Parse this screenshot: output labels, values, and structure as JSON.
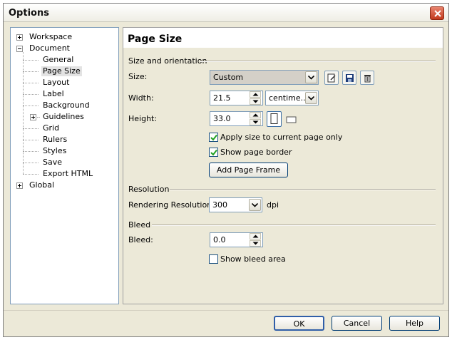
{
  "window": {
    "title": "Options"
  },
  "tree": {
    "items": [
      {
        "label": "Workspace",
        "level": 0,
        "expander": "plus"
      },
      {
        "label": "Document",
        "level": 0,
        "expander": "minus"
      },
      {
        "label": "General",
        "level": 1
      },
      {
        "label": "Page Size",
        "level": 1,
        "selected": true
      },
      {
        "label": "Layout",
        "level": 1
      },
      {
        "label": "Label",
        "level": 1
      },
      {
        "label": "Background",
        "level": 1
      },
      {
        "label": "Guidelines",
        "level": 1,
        "expander": "plus"
      },
      {
        "label": "Grid",
        "level": 1
      },
      {
        "label": "Rulers",
        "level": 1
      },
      {
        "label": "Styles",
        "level": 1
      },
      {
        "label": "Save",
        "level": 1
      },
      {
        "label": "Export HTML",
        "level": 1
      },
      {
        "label": "Global",
        "level": 0,
        "expander": "plus"
      }
    ]
  },
  "page": {
    "title": "Page Size",
    "size_orientation": {
      "section": "Size and orientation",
      "size_label": "Size:",
      "size_value": "Custom",
      "width_label": "Width:",
      "width_value": "21.5",
      "unit_value": "centime...",
      "height_label": "Height:",
      "height_value": "33.0",
      "apply_current_label": "Apply size to current page only",
      "apply_current_checked": true,
      "show_border_label": "Show page border",
      "show_border_checked": true,
      "add_frame_label": "Add Page Frame"
    },
    "resolution": {
      "section": "Resolution",
      "rendering_label": "Rendering Resolution:",
      "rendering_value": "300",
      "unit": "dpi"
    },
    "bleed": {
      "section": "Bleed",
      "bleed_label": "Bleed:",
      "bleed_value": "0.0",
      "show_bleed_label": "Show bleed area",
      "show_bleed_checked": false
    }
  },
  "footer": {
    "ok": "OK",
    "cancel": "Cancel",
    "help": "Help"
  },
  "colors": {
    "accent_border": "#7f9db9",
    "close_red": "#c2391c",
    "check_green": "#21a121",
    "window_face": "#ece9d8"
  },
  "icons": {
    "close": "close-icon",
    "size_edit": "edit-page-icon",
    "size_save": "save-disk-icon",
    "size_delete": "trash-icon",
    "portrait": "portrait-orientation-icon",
    "landscape": "landscape-orientation-icon"
  }
}
